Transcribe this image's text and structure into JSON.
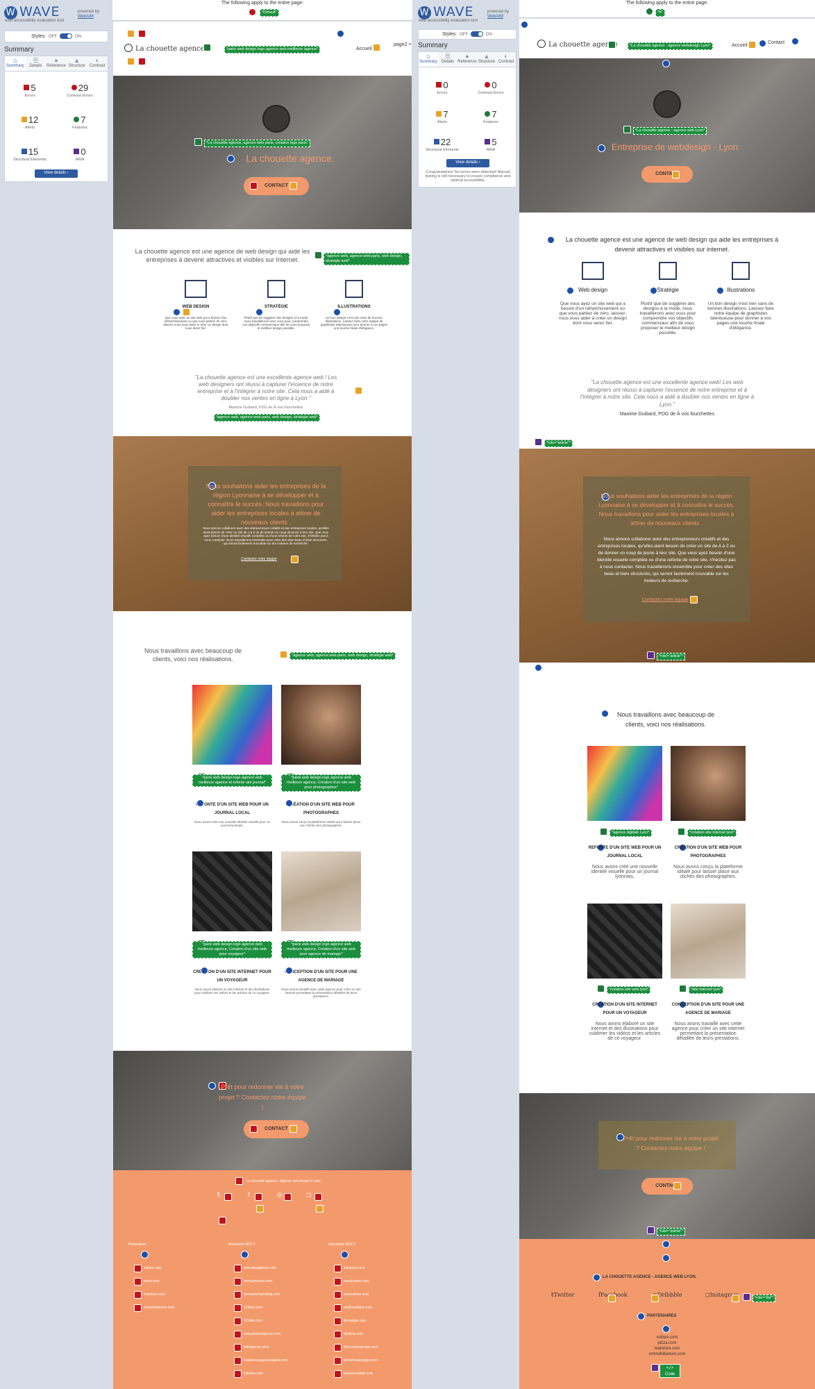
{
  "left": {
    "wave": {
      "brand": "WAVE",
      "subtitle": "web accessibility evaluation tool",
      "powered": "powered by",
      "webaim": "WebAIM"
    },
    "styles": {
      "label": "Styles:",
      "off": "OFF",
      "on": "ON"
    },
    "summary_title": "Summary",
    "tabs": [
      "Summary",
      "Details",
      "Reference",
      "Structure",
      "Contrast"
    ],
    "stats": [
      {
        "n": "5",
        "l": "Errors",
        "c": "#c0141c"
      },
      {
        "n": "29",
        "l": "Contrast Errors",
        "c": "#c0141c"
      },
      {
        "n": "12",
        "l": "Alerts",
        "c": "#e8a227"
      },
      {
        "n": "7",
        "l": "Features",
        "c": "#1e7a3a"
      },
      {
        "n": "15",
        "l": "Structural Elements",
        "c": "#2d5aa0"
      },
      {
        "n": "0",
        "l": "ARIA",
        "c": "#5a2d91"
      }
    ],
    "view_details": "View details ›",
    "banner": "The following apply to the entire page:",
    "banner_label": "*Default*",
    "site": {
      "logo": "La chouette agence",
      "logo_alt": "*paris web design logo agence web meilleure agence*",
      "nav_home": "Accueil",
      "nav_page2": "page2 >",
      "hero_alt": "*La chouette agence, agence web paris, création logo paris*",
      "hero_title": "La chouette agence.",
      "contact_btn": "CONTACT",
      "intro": "La chouette agence est une agence de web design qui aide les entreprises à devenir attractives et visibles sur Internet.",
      "intro_alt": "*agence web, agence web paris, web design, stratégie web*",
      "services": [
        {
          "h": "WEB DESIGN",
          "p": "Que vous ayez un site web qui a besoin d'un rafraîchissement ou que vous partiez de zéro, laissez-nous vous aider à créer un design dont vous serez fier."
        },
        {
          "h": "STRATÉGIE",
          "p": "Plutôt que de suggérer des designs à la mode, nous travaillerons avec vous pour comprendre vos objectifs commerciaux afin de vous proposer le meilleur design possible."
        },
        {
          "h": "ILLUSTRATIONS",
          "p": "Un bon design n'est rien sans de bonnes illustrations. Laissez faire notre équipe de graphistes talentueuse pour donner à vos pages une touche finale d'élégance."
        }
      ],
      "quote": "\"La chouette agence est une excellente agence web ! Les web designers ont réussi à capturer l'essence de notre entreprise et à l'intégrer à notre site. Cela nous a aidé à doubler nos ventes en ligne à Lyon.\"",
      "quote_author": "Maxime Guibard, PDG de À vos fourchettes",
      "quote_alt": "*agence web, agence web paris, web design, stratégie web*",
      "brown_h": "Nous souhaitons aider les entreprises de la région Lyonnaise à se développer et à connaître le succès. Nous travaillons pour aider les entreprises locales à attirer de nouveaux clients .",
      "brown_p": "Nous aimons collaborer avec des entrepreneurs créatifs et des entreprises locales, qu'elles aient besoin de créer un site de A à Z ou de donner un coup de jeune à leur site. Que vous ayez besoin d'une identité visuelle complète ou d'une refonte de votre site, n'hésitez pas à nous contacter. Nous travaillerons ensemble pour créer des sites beau et bien structurés, qui seront facilement trouvable sur les moteurs de recherche.",
      "brown_link": "Contactez notre équipe",
      "works_title": "Nous travaillons avec beaucoup de clients, voici nos réalisations.",
      "works_alt": "*agence web, agence web paris, web design, stratégie web*",
      "works": [
        {
          "alt": "*paris web design logo agence web meilleure agence et refonte site journal*",
          "h": "REFONTE D'UN SITE WEB POUR UN JOURNAL LOCAL",
          "p": "Nous avons créé une nouvelle identité visuelle pour un journal lyonnais."
        },
        {
          "alt": "*paris web design logo agence web meilleure agence, Création d'un site web pour photographes*",
          "h": "CRÉATION D'UN SITE WEB POUR PHOTOGRAPHES",
          "p": "Nous avons conçu la plateforme idéale pour laisser place aux clichés des photographes."
        },
        {
          "alt": "*paris web design logo agence web meilleure agence, Création d'un site web pour voyageur*",
          "h": "CRÉATION D'UN SITE INTERNET POUR UN VOYAGEUR",
          "p": "Nous avons élaboré un site internet et des illustrations pour sublimer les vidéos et les articles de ce voyageur."
        },
        {
          "alt": "*paris web design logo agence web meilleure agence, Création d'un site web pour agence de mariage*",
          "h": "CONCEPTION D'UN SITE POUR UNE AGENCE DE MARIAGE",
          "p": "Nous avons travaillé avec cette agence pour créer un site internet permettant la présentation détaillée de leurs prestations."
        }
      ],
      "cta": "Prêt pour redonner vie à votre projet ? Contactez notre équipe !",
      "footer_brand": "La chouette agence - Agence web basée à Lyon",
      "footer_cols": [
        {
          "h": "Partenaires",
          "items": [
            "vollure.com",
            "pizza.com",
            "matofure.com",
            "ommobiliances.com"
          ]
        },
        {
          "h": "Annuaires SEO 1",
          "items": [
            "annuaireagence.com",
            "annuairesseo.com",
            "annuairemarketing.com",
            "123seo.com",
            "123site.com",
            "annuairewordpress.com",
            "listeagence.com",
            "meilleuresagencesparis.com",
            "listeseo.com"
          ]
        },
        {
          "h": "Annuaires SEO 2",
          "items": [
            "listesseo.com",
            "prestionseo.com",
            "seoposition.com",
            "meilleursliens.com",
            "liensgogo.com",
            "topliens.com",
            "linkyouseeurcase.com",
            "tenoirlesseogogo.com",
            "listesseofaible.com"
          ]
        }
      ]
    }
  },
  "right": {
    "wave": {
      "brand": "WAVE",
      "subtitle": "web accessibility evaluation tool",
      "powered": "powered by",
      "webaim": "WebAIM"
    },
    "styles": {
      "label": "Styles:",
      "off": "OFF",
      "on": "ON"
    },
    "summary_title": "Summary",
    "tabs": [
      "Summary",
      "Details",
      "Reference",
      "Structure",
      "Contrast"
    ],
    "stats": [
      {
        "n": "0",
        "l": "Errors",
        "c": "#c0141c"
      },
      {
        "n": "0",
        "l": "Contrast Errors",
        "c": "#c0141c"
      },
      {
        "n": "7",
        "l": "Alerts",
        "c": "#e8a227"
      },
      {
        "n": "7",
        "l": "Features",
        "c": "#1e7a3a"
      },
      {
        "n": "22",
        "l": "Structural Elements",
        "c": "#2d5aa0"
      },
      {
        "n": "5",
        "l": "ARIA",
        "c": "#5a2d91"
      }
    ],
    "view_details": "View details ›",
    "congrats": "Congratulations! No errors were detected! Manual testing is still necessary to ensure compliance and optimal accessibility.",
    "banner": "The following apply to the entire page:",
    "banner_label": "*fr*",
    "site": {
      "logo": "La chouette agence",
      "logo_alt": "*La chouette agence - agence webdesign Lyon*",
      "nav_home": "Accueil",
      "nav_contact": "Contact",
      "hero_alt": "*La chouette agence - agence web Lyon*",
      "hero_title": "Entreprise de webdesign - Lyon",
      "contact_btn": "CONTACT",
      "intro": "La chouette agence est une agence de web design qui aide les entreprises à devenir attractives et visibles sur internet.",
      "services": [
        {
          "h": "Web design",
          "p": "Que vous ayez un site web qui a besoin d'un rafraîchissement ou que vous partiez de zéro, laissez-nous vous aider à créer un design dont vous serez fier."
        },
        {
          "h": "Stratégie",
          "p": "Plutôt que de suggérer des designs à la mode, nous travaillerons avec vous pour comprendre vos objectifs commerciaux afin de vous proposer le meilleur design possible."
        },
        {
          "h": "Illustrations",
          "p": "Un bon design n'est rien sans de bonnes illustrations. Laissez faire notre équipe de graphistes talentueuse pour donner à vos pages une touche finale d'élégance."
        }
      ],
      "quote": "\"La chouette agence est une excellente agence web! Les web designers ont réussi à capturer l'essence de notre entreprise et à l'intégrer à notre site. Cela nous a aidé à doubler nos ventes en ligne à Lyon.\"",
      "quote_author": "Maxime Guibard, PDG de À vos fourchettes",
      "role_article": "*role=\"article\"*",
      "brown_h": "Nous souhaitons aider les entreprises de la région Lyonnaise à se développer et à connaître le succès. Nous travaillons pour aider les entreprises locales à attirer de nouveaux clients .",
      "brown_p": "Nous aimons collaborer avec des entrepreneurs créatifs et des entreprises locales, qu'elles aient besoin de créer un site de A à Z ou de donner un coup de jeune à leur site. Que vous ayez besoin d'une identité visuelle complète ou d'une refonte de votre site, n'hésitez pas à nous contacter. Nous travaillerons ensemble pour créer des sites beau et bien structurés, qui seront facilement trouvable sur les moteurs de recherche.",
      "brown_link": "Contactez notre équipe",
      "works_title": "Nous travaillons avec beaucoup de clients, voici nos réalisations.",
      "works": [
        {
          "alt": "*agence digitale Lyon*",
          "h": "REFONTE D'UN SITE WEB POUR UN JOURNAL LOCAL",
          "p": "Nous avons créé une nouvelle identité visuelle pour un journal lyonnais."
        },
        {
          "alt": "*création site internet lyon*",
          "h": "CRÉATION D'UN SITE WEB POUR PHOTOGRAPHES",
          "p": "Nous avons conçu la plateforme idéale pour laisser place aux clichés des photographes."
        },
        {
          "alt": "*création site web lyon*",
          "h": "CRÉATION D'UN SITE INTERNET POUR UN VOYAGEUR",
          "p": "Nous avons élaboré un site internet et des illustrations pour sublimer les vidéos et les articles de ce voyageur."
        },
        {
          "alt": "*site internet lyon*",
          "h": "CONCEPTION D'UN SITE POUR UNE AGENCE DE MARIAGE",
          "p": "Nous avons travaillé avec cette agence pour créer un site internet permettant la présentation détaillée de leurs prestations."
        }
      ],
      "cta": "Prêt pour redonner vie à votre projet ? Contactez notre équipe !",
      "footer_brand": "LA CHOUETTE AGENCE - AGENCE WEB LYON.",
      "social": [
        "Twitter",
        "Facebook",
        "Dribbble",
        "Instagram"
      ],
      "role_list": "*role=\"list\"*",
      "partners_h": "PARTENAIRES",
      "partners": [
        "vollure.com",
        "pizza.com",
        "matofure.com",
        "ommobiliances.com"
      ],
      "code_label": "Code"
    }
  }
}
